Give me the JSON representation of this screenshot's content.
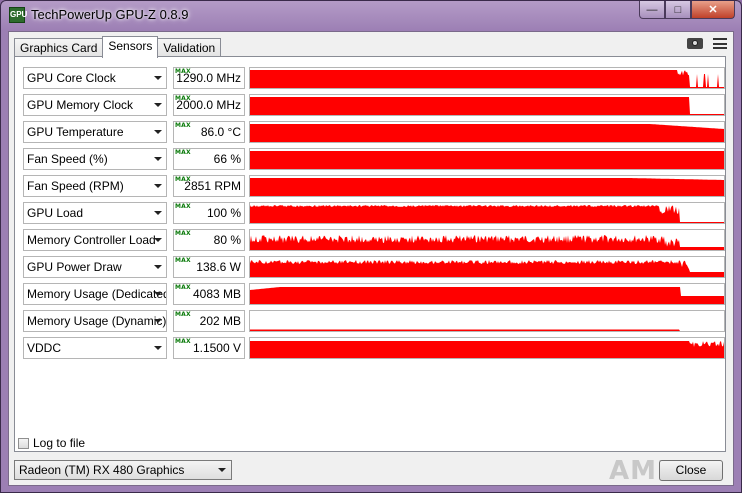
{
  "window": {
    "title": "TechPowerUp GPU-Z 0.8.9",
    "app_icon_text": "GPU",
    "caption": {
      "minimize": "—",
      "maximize": "□",
      "close": "✕"
    }
  },
  "tabs": [
    {
      "label": "Graphics Card",
      "active": false
    },
    {
      "label": "Sensors",
      "active": true
    },
    {
      "label": "Validation",
      "active": false
    }
  ],
  "toolbar": {
    "camera_icon": "camera-icon",
    "menu_icon": "hamburger-menu-icon"
  },
  "max_label": "MAX",
  "sensors": [
    {
      "label": "GPU Core Clock",
      "value": "1290.0 MHz"
    },
    {
      "label": "GPU Memory Clock",
      "value": "2000.0 MHz"
    },
    {
      "label": "GPU Temperature",
      "value": "86.0 °C"
    },
    {
      "label": "Fan Speed (%)",
      "value": "66 %"
    },
    {
      "label": "Fan Speed (RPM)",
      "value": "2851 RPM"
    },
    {
      "label": "GPU Load",
      "value": "100 %"
    },
    {
      "label": "Memory Controller Load",
      "value": "80 %"
    },
    {
      "label": "GPU Power Draw",
      "value": "138.6 W"
    },
    {
      "label": "Memory Usage (Dedicated)",
      "value": "4083 MB"
    },
    {
      "label": "Memory Usage (Dynamic)",
      "value": "202 MB"
    },
    {
      "label": "VDDC",
      "value": "1.1500 V"
    }
  ],
  "log_to_file": {
    "label": "Log to file",
    "checked": false
  },
  "device_select": {
    "value": "Radeon (TM) RX 480 Graphics"
  },
  "close_button": {
    "label": "Close"
  },
  "brand": {
    "logo_text": "AMD"
  },
  "colors": {
    "graph": "#ff0000",
    "max_text": "#0a7a0a"
  }
}
